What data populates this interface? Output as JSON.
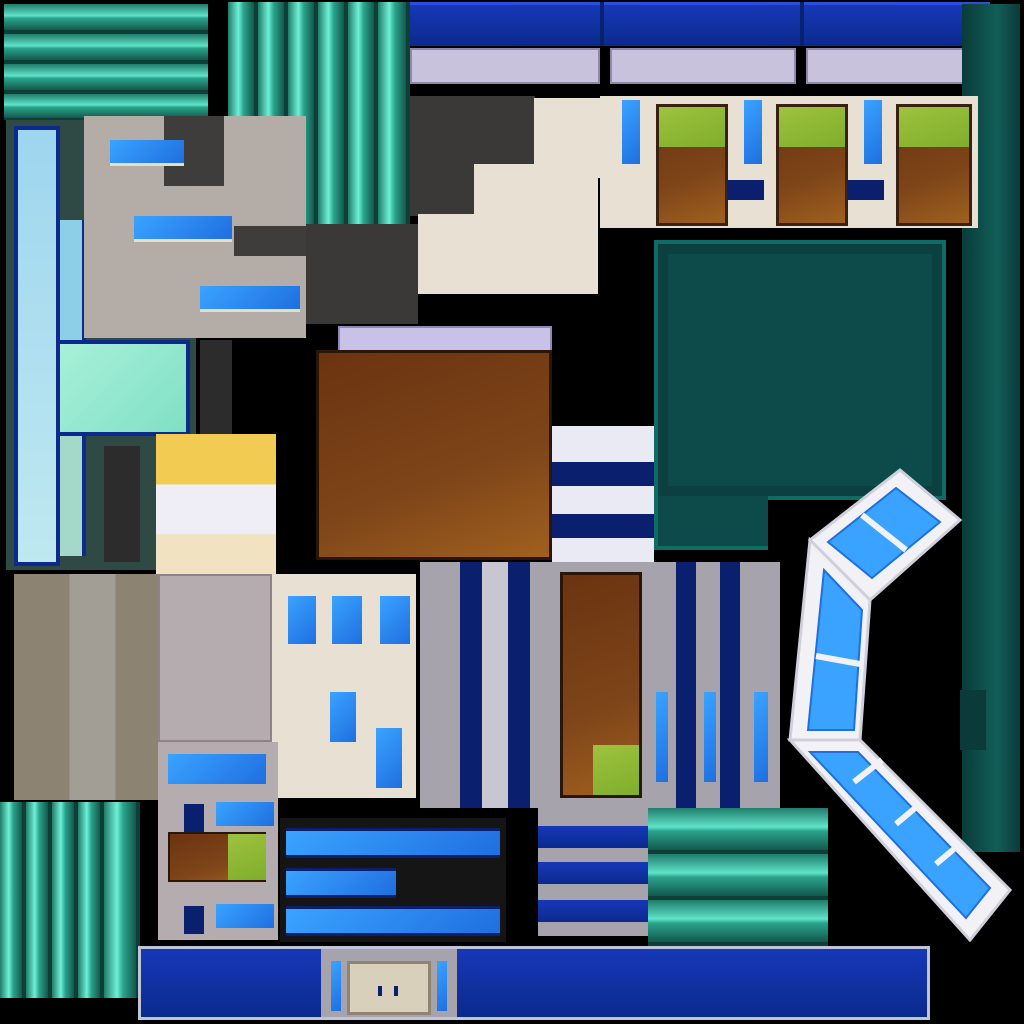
{
  "atlas": {
    "kind": "texture-atlas",
    "regions": [
      "teal-roof-strips",
      "teal-column-panels",
      "blue-roof-trim",
      "glass-tower-frame",
      "gray-wall-with-windows",
      "cream-stepped-roof",
      "door-panels-with-grass",
      "dark-teal-roof-panel",
      "brown-ground-patch",
      "blue-white-stripes",
      "yellow-white-facade",
      "glass-arch-walkway",
      "storefront-facade",
      "blue-window-bands",
      "navy-base-with-door"
    ]
  },
  "colors": {
    "background": "#000000",
    "teal": "#2aa48c",
    "navy": "#0a1f6e",
    "royal_blue": "#1638b8",
    "glass_blue": "#3aa3ff",
    "cream": "#e9e0d4",
    "brown": "#7e4519",
    "grass": "#8fb835",
    "dark_teal": "#0d4a4a"
  }
}
